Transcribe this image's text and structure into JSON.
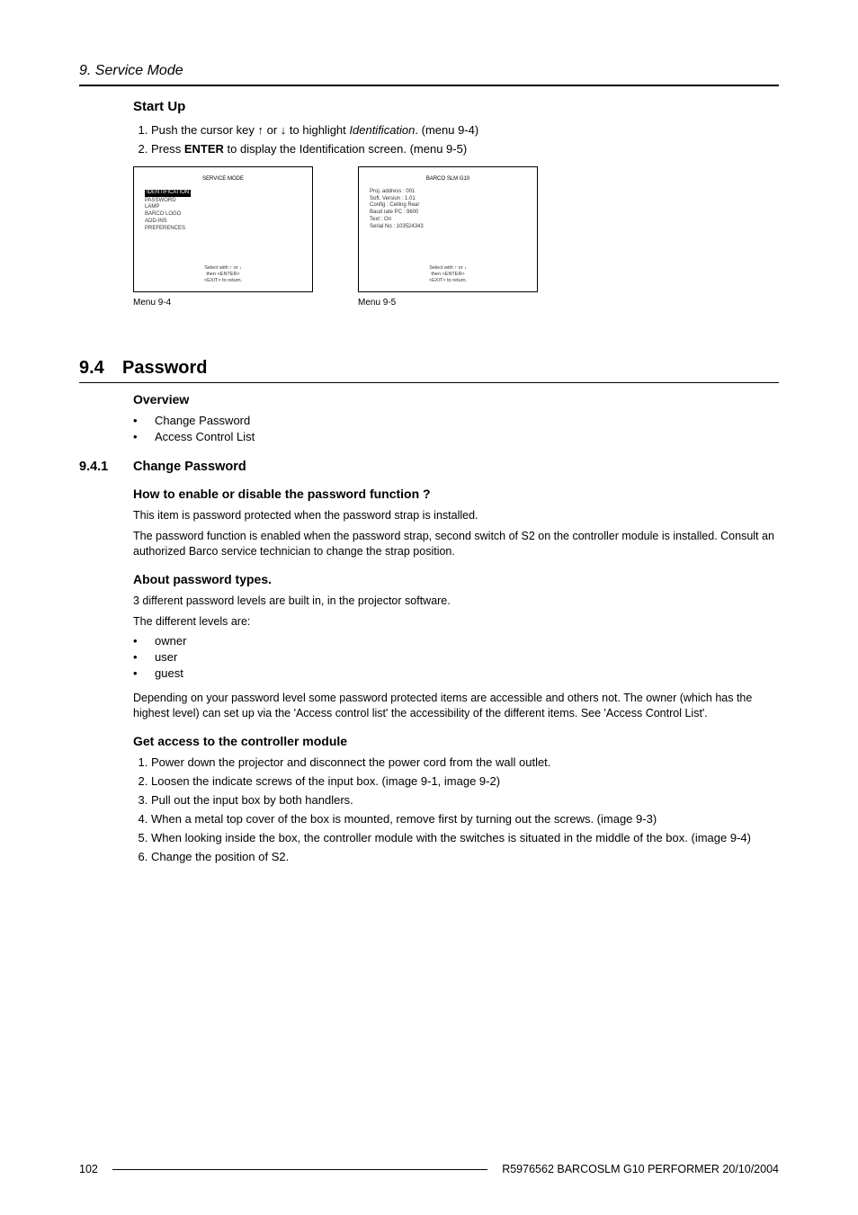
{
  "header": {
    "chapter": "9. Service Mode"
  },
  "startup": {
    "title": "Start Up",
    "steps": [
      {
        "pre": "Push the cursor key ↑ or ↓ to highlight ",
        "em": "Identification",
        "post": ". (menu 9-4)"
      },
      {
        "pre": "Press ",
        "strong": "ENTER",
        "post": " to display the Identification screen. (menu 9-5)"
      }
    ]
  },
  "menus": {
    "m1": {
      "title": "SERVICE MODE",
      "highlight": "IDENTIFICATION",
      "items": [
        "PASSWORD",
        "LAMP",
        "BARCO LOGO",
        "ADD-INS",
        "PREFERENCES"
      ],
      "footer_prefix": "Select with ",
      "footer_or": " or ",
      "footer_suffix": "then <ENTER>",
      "footer_exit": "<EXIT> to return.",
      "caption": "Menu 9-4"
    },
    "m2": {
      "title": "BARCO SLM G10",
      "lines": [
        "Proj. address : 001",
        "Soft. Version :  1.01",
        "Config : Ceiling Rear",
        "Baud rate PC :  9600",
        "Text : On",
        "Serial No : 103524343"
      ],
      "footer_prefix": "Select with ",
      "footer_or": " or ",
      "footer_suffix": "then <ENTER>",
      "footer_exit": "<EXIT> to return.",
      "caption": "Menu 9-5"
    }
  },
  "section": {
    "num": "9.4",
    "title": "Password",
    "overview": {
      "title": "Overview",
      "items": [
        "Change Password",
        "Access Control List"
      ]
    }
  },
  "subsection": {
    "num": "9.4.1",
    "title": "Change Password",
    "howto": {
      "title": "How to enable or disable the password function ?",
      "p1": "This item is password protected when the password strap is installed.",
      "p2": "The password function is enabled when the password strap, second switch of S2 on the controller module is installed. Consult an authorized Barco service technician to change the strap position."
    },
    "types": {
      "title": "About password types.",
      "p1": "3 different password levels are built in, in the projector software.",
      "p2": "The different levels are:",
      "items": [
        "owner",
        "user",
        "guest"
      ],
      "p3": "Depending on your password level some password protected items are accessible and others not. The owner (which has the highest level) can set up via the 'Access control list' the accessibility of the different items. See 'Access Control List'."
    },
    "access": {
      "title": "Get access to the controller module",
      "steps": [
        "Power down the projector and disconnect the power cord from the wall outlet.",
        "Loosen the indicate screws of the input box. (image 9-1, image 9-2)",
        "Pull out the input box by both handlers.",
        "When a metal top cover of the box is mounted, remove first by turning out the screws. (image 9-3)",
        "When looking inside the box, the controller module with the switches is situated in the middle of the box. (image 9-4)",
        "Change the position of S2."
      ]
    }
  },
  "footer": {
    "page": "102",
    "doc": "R5976562  BARCOSLM G10 PERFORMER  20/10/2004"
  }
}
